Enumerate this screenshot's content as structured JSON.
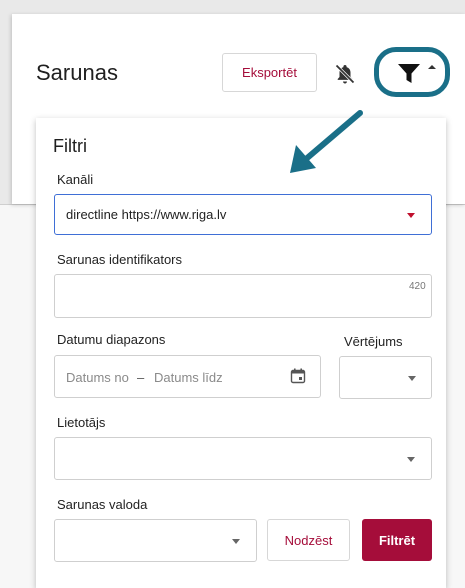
{
  "header": {
    "title": "Sarunas",
    "export_label": "Eksportēt",
    "icons": {
      "notifications": "bell-off-icon",
      "filter": "funnel-icon",
      "caret": "caret-up-icon"
    },
    "accent_color": "#a50d3a",
    "highlight_color": "#1a6f88"
  },
  "filters": {
    "title": "Filtri",
    "channels": {
      "label": "Kanāli",
      "value": "directline https://www.riga.lv"
    },
    "conversation_id": {
      "label": "Sarunas identifikators",
      "counter": "420"
    },
    "date_range": {
      "label": "Datumu diapazons",
      "from_placeholder": "Datums no",
      "separator": "–",
      "to_placeholder": "Datums līdz"
    },
    "rating": {
      "label": "Vērtējums"
    },
    "user": {
      "label": "Lietotājs"
    },
    "language": {
      "label": "Sarunas valoda"
    },
    "clear_label": "Nodzēst",
    "apply_label": "Filtrēt"
  }
}
